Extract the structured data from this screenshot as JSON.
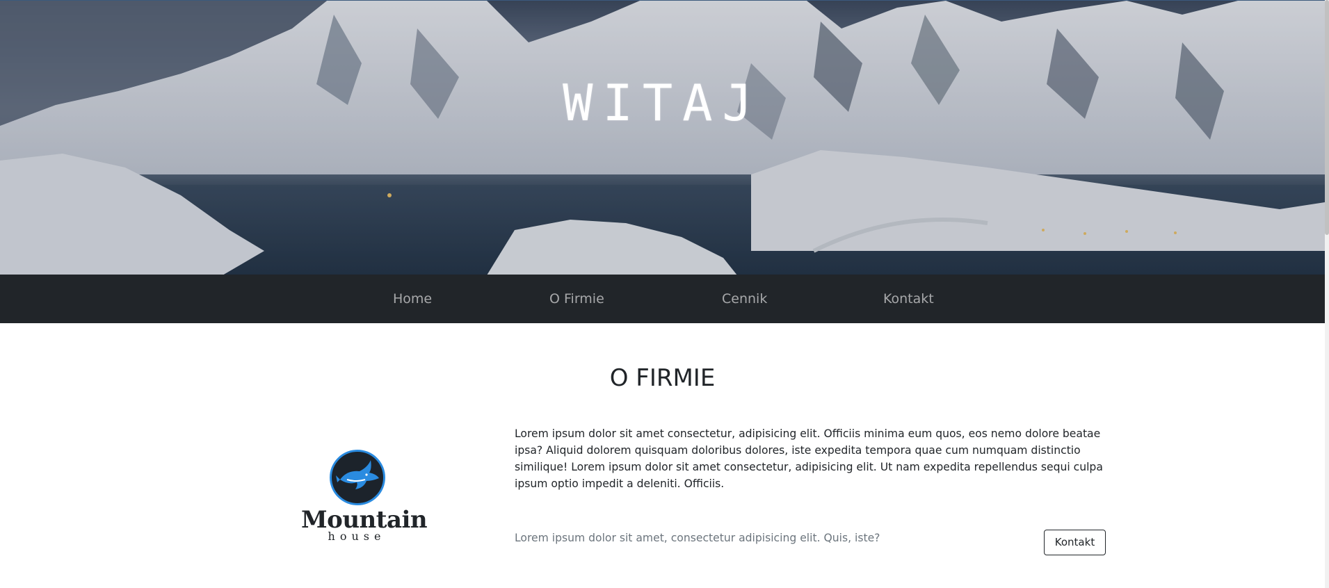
{
  "hero": {
    "title": "WITAJ",
    "image_icon": "snowy-mountain-fjord-photo"
  },
  "navbar": {
    "items": [
      {
        "label": "Home"
      },
      {
        "label": "O Firmie"
      },
      {
        "label": "Cennik"
      },
      {
        "label": "Kontakt"
      }
    ]
  },
  "about": {
    "title": "O FIRMIE",
    "paragraph": "Lorem ipsum dolor sit amet consectetur, adipisicing elit. Officiis minima eum quos, eos nemo dolore beatae ipsa? Aliquid dolorem quisquam doloribus dolores, iste expedita tempora quae cum numquam distinctio similique! Lorem ipsum dolor sit amet consectetur, adipisicing elit. Ut nam expedita repellendus sequi culpa ipsum optio impedit a deleniti. Officiis.",
    "muted": "Lorem ipsum dolor sit amet, consectetur adipisicing elit. Quis, iste?",
    "button_label": "Kontakt"
  },
  "logo": {
    "name": "Mountain",
    "sub": "house",
    "icon": "shark-icon"
  },
  "colors": {
    "navbar_bg": "#212529",
    "nav_text": "rgba(255,255,255,0.6)",
    "logo_ring": "#2a8be0",
    "muted": "#6c757d"
  }
}
